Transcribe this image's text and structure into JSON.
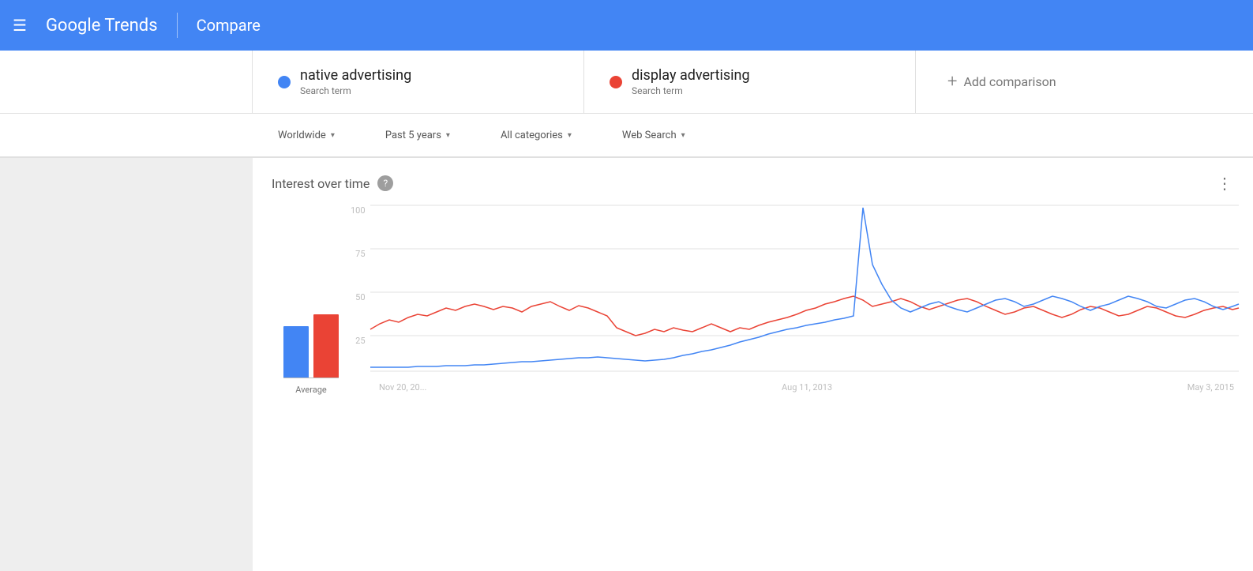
{
  "header": {
    "menu_icon": "☰",
    "logo_text": "Google Trends",
    "divider": true,
    "compare_label": "Compare"
  },
  "search_terms": [
    {
      "id": "term1",
      "name": "native advertising",
      "type": "Search term",
      "dot_color": "#4285f4"
    },
    {
      "id": "term2",
      "name": "display advertising",
      "type": "Search term",
      "dot_color": "#ea4335"
    }
  ],
  "add_comparison": {
    "plus": "+",
    "label": "Add comparison"
  },
  "filters": [
    {
      "id": "region",
      "label": "Worldwide",
      "arrow": "▾"
    },
    {
      "id": "time",
      "label": "Past 5 years",
      "arrow": "▾"
    },
    {
      "id": "category",
      "label": "All categories",
      "arrow": "▾"
    },
    {
      "id": "search_type",
      "label": "Web Search",
      "arrow": "▾"
    }
  ],
  "chart": {
    "title": "Interest over time",
    "help_icon": "?",
    "more_icon": "⋮",
    "y_labels": [
      "100",
      "75",
      "50",
      "25"
    ],
    "x_labels": [
      "Nov 20, 20...",
      "Aug 11, 2013",
      "May 3, 2015"
    ],
    "bar_label": "Average",
    "bars": [
      {
        "color": "#4285f4",
        "height_pct": 65
      },
      {
        "color": "#ea4335",
        "height_pct": 80
      }
    ]
  }
}
